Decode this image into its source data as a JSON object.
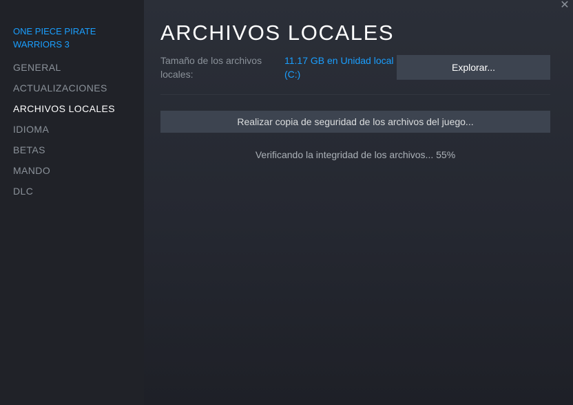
{
  "sidebar": {
    "game_title": "ONE PIECE PIRATE WARRIORS 3",
    "items": [
      {
        "label": "GENERAL",
        "active": false
      },
      {
        "label": "ACTUALIZACIONES",
        "active": false
      },
      {
        "label": "ARCHIVOS LOCALES",
        "active": true
      },
      {
        "label": "IDIOMA",
        "active": false
      },
      {
        "label": "BETAS",
        "active": false
      },
      {
        "label": "MANDO",
        "active": false
      },
      {
        "label": "DLC",
        "active": false
      }
    ]
  },
  "window": {
    "close_icon": "close-icon",
    "close_glyph": "✕"
  },
  "main": {
    "title": "ARCHIVOS LOCALES",
    "size_label": "Tamaño de los archivos locales:",
    "size_value": "11.17 GB en Unidad local (C:)",
    "browse_label": "Explorar...",
    "backup_label": "Realizar copia de seguridad de los archivos del juego...",
    "status": "Verificando la integridad de los archivos... 55%",
    "verify_progress_percent": 55
  },
  "colors": {
    "accent": "#1a9fff",
    "sidebar_bg": "#202228",
    "button_bg": "#3d4450",
    "text_muted": "#8b929a"
  }
}
